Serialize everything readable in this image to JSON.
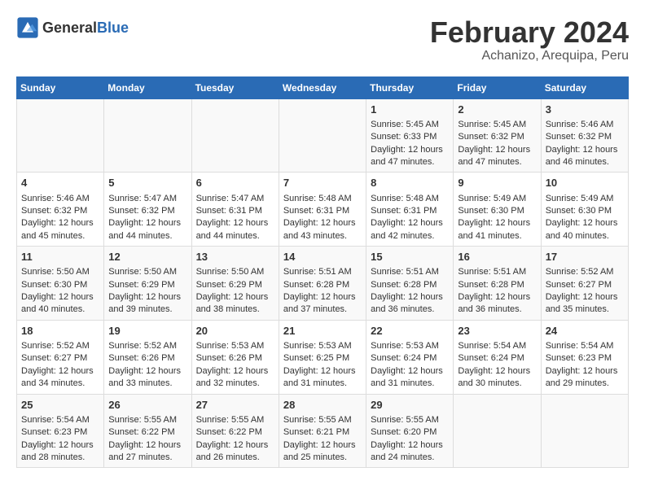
{
  "logo": {
    "general": "General",
    "blue": "Blue"
  },
  "title": "February 2024",
  "subtitle": "Achanizo, Arequipa, Peru",
  "days_of_week": [
    "Sunday",
    "Monday",
    "Tuesday",
    "Wednesday",
    "Thursday",
    "Friday",
    "Saturday"
  ],
  "weeks": [
    [
      {
        "day": "",
        "content": ""
      },
      {
        "day": "",
        "content": ""
      },
      {
        "day": "",
        "content": ""
      },
      {
        "day": "",
        "content": ""
      },
      {
        "day": "1",
        "content": "Sunrise: 5:45 AM\nSunset: 6:33 PM\nDaylight: 12 hours and 47 minutes."
      },
      {
        "day": "2",
        "content": "Sunrise: 5:45 AM\nSunset: 6:32 PM\nDaylight: 12 hours and 47 minutes."
      },
      {
        "day": "3",
        "content": "Sunrise: 5:46 AM\nSunset: 6:32 PM\nDaylight: 12 hours and 46 minutes."
      }
    ],
    [
      {
        "day": "4",
        "content": "Sunrise: 5:46 AM\nSunset: 6:32 PM\nDaylight: 12 hours and 45 minutes."
      },
      {
        "day": "5",
        "content": "Sunrise: 5:47 AM\nSunset: 6:32 PM\nDaylight: 12 hours and 44 minutes."
      },
      {
        "day": "6",
        "content": "Sunrise: 5:47 AM\nSunset: 6:31 PM\nDaylight: 12 hours and 44 minutes."
      },
      {
        "day": "7",
        "content": "Sunrise: 5:48 AM\nSunset: 6:31 PM\nDaylight: 12 hours and 43 minutes."
      },
      {
        "day": "8",
        "content": "Sunrise: 5:48 AM\nSunset: 6:31 PM\nDaylight: 12 hours and 42 minutes."
      },
      {
        "day": "9",
        "content": "Sunrise: 5:49 AM\nSunset: 6:30 PM\nDaylight: 12 hours and 41 minutes."
      },
      {
        "day": "10",
        "content": "Sunrise: 5:49 AM\nSunset: 6:30 PM\nDaylight: 12 hours and 40 minutes."
      }
    ],
    [
      {
        "day": "11",
        "content": "Sunrise: 5:50 AM\nSunset: 6:30 PM\nDaylight: 12 hours and 40 minutes."
      },
      {
        "day": "12",
        "content": "Sunrise: 5:50 AM\nSunset: 6:29 PM\nDaylight: 12 hours and 39 minutes."
      },
      {
        "day": "13",
        "content": "Sunrise: 5:50 AM\nSunset: 6:29 PM\nDaylight: 12 hours and 38 minutes."
      },
      {
        "day": "14",
        "content": "Sunrise: 5:51 AM\nSunset: 6:28 PM\nDaylight: 12 hours and 37 minutes."
      },
      {
        "day": "15",
        "content": "Sunrise: 5:51 AM\nSunset: 6:28 PM\nDaylight: 12 hours and 36 minutes."
      },
      {
        "day": "16",
        "content": "Sunrise: 5:51 AM\nSunset: 6:28 PM\nDaylight: 12 hours and 36 minutes."
      },
      {
        "day": "17",
        "content": "Sunrise: 5:52 AM\nSunset: 6:27 PM\nDaylight: 12 hours and 35 minutes."
      }
    ],
    [
      {
        "day": "18",
        "content": "Sunrise: 5:52 AM\nSunset: 6:27 PM\nDaylight: 12 hours and 34 minutes."
      },
      {
        "day": "19",
        "content": "Sunrise: 5:52 AM\nSunset: 6:26 PM\nDaylight: 12 hours and 33 minutes."
      },
      {
        "day": "20",
        "content": "Sunrise: 5:53 AM\nSunset: 6:26 PM\nDaylight: 12 hours and 32 minutes."
      },
      {
        "day": "21",
        "content": "Sunrise: 5:53 AM\nSunset: 6:25 PM\nDaylight: 12 hours and 31 minutes."
      },
      {
        "day": "22",
        "content": "Sunrise: 5:53 AM\nSunset: 6:24 PM\nDaylight: 12 hours and 31 minutes."
      },
      {
        "day": "23",
        "content": "Sunrise: 5:54 AM\nSunset: 6:24 PM\nDaylight: 12 hours and 30 minutes."
      },
      {
        "day": "24",
        "content": "Sunrise: 5:54 AM\nSunset: 6:23 PM\nDaylight: 12 hours and 29 minutes."
      }
    ],
    [
      {
        "day": "25",
        "content": "Sunrise: 5:54 AM\nSunset: 6:23 PM\nDaylight: 12 hours and 28 minutes."
      },
      {
        "day": "26",
        "content": "Sunrise: 5:55 AM\nSunset: 6:22 PM\nDaylight: 12 hours and 27 minutes."
      },
      {
        "day": "27",
        "content": "Sunrise: 5:55 AM\nSunset: 6:22 PM\nDaylight: 12 hours and 26 minutes."
      },
      {
        "day": "28",
        "content": "Sunrise: 5:55 AM\nSunset: 6:21 PM\nDaylight: 12 hours and 25 minutes."
      },
      {
        "day": "29",
        "content": "Sunrise: 5:55 AM\nSunset: 6:20 PM\nDaylight: 12 hours and 24 minutes."
      },
      {
        "day": "",
        "content": ""
      },
      {
        "day": "",
        "content": ""
      }
    ]
  ],
  "accent_color": "#2a6bb5"
}
